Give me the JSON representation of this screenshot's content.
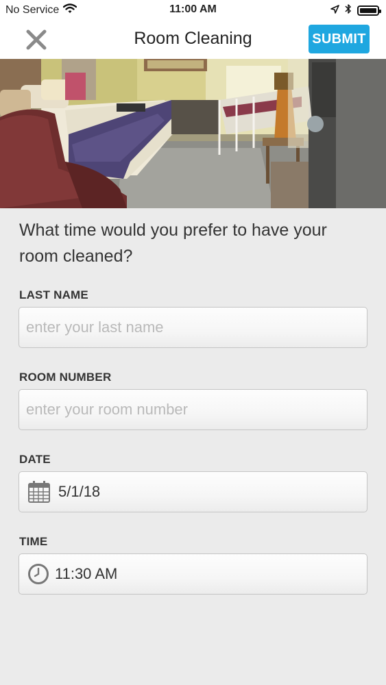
{
  "status_bar": {
    "carrier": "No Service",
    "time": "11:00 AM"
  },
  "nav": {
    "title": "Room Cleaning",
    "submit_label": "SUBMIT"
  },
  "form": {
    "question": "What time would you prefer to have your room cleaned?",
    "last_name": {
      "label": "LAST NAME",
      "placeholder": "enter your last name",
      "value": ""
    },
    "room_number": {
      "label": "ROOM NUMBER",
      "placeholder": "enter your room number",
      "value": ""
    },
    "date": {
      "label": "DATE",
      "value": "5/1/18",
      "icon": "calendar-icon"
    },
    "time": {
      "label": "TIME",
      "value": "11:30 AM",
      "icon": "clock-icon"
    }
  },
  "icons": [
    "wifi-icon",
    "location-arrow-icon",
    "bluetooth-icon",
    "battery-icon",
    "close-icon",
    "calendar-icon",
    "clock-icon"
  ],
  "colors": {
    "accent": "#1fa7e0",
    "background": "#ebebeb",
    "header": "#ffffff"
  }
}
